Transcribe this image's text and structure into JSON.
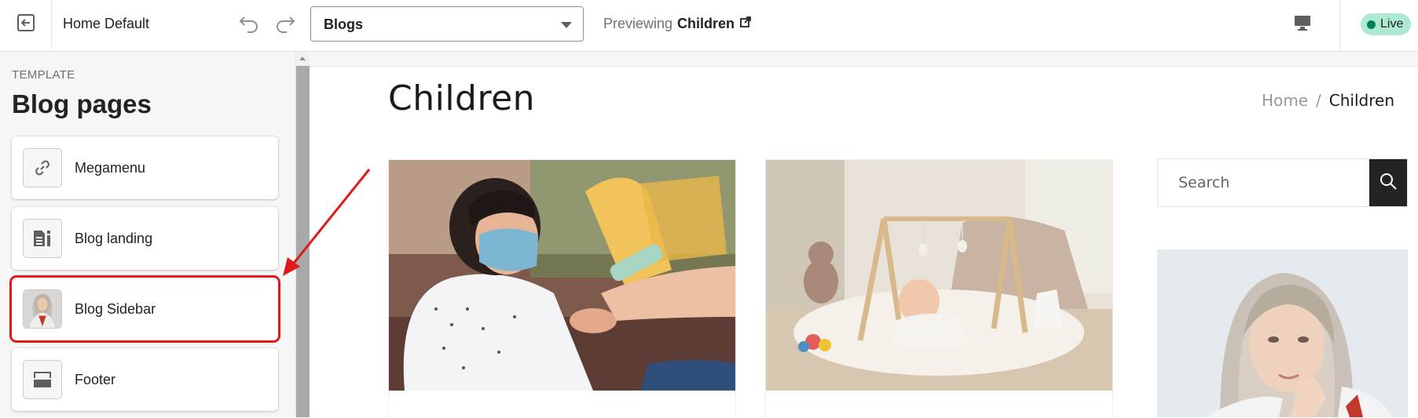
{
  "topbar": {
    "theme_name": "Home Default",
    "template_select_value": "Blogs",
    "previewing_label": "Previewing",
    "previewing_page": "Children",
    "status_badge": "Live"
  },
  "sidebar": {
    "section_label": "TEMPLATE",
    "title": "Blog pages",
    "items": [
      {
        "label": "Megamenu",
        "icon": "link-icon"
      },
      {
        "label": "Blog landing",
        "icon": "blog-landing-icon"
      },
      {
        "label": "Blog Sidebar",
        "icon": "blog-sidebar-thumbnail",
        "highlighted": true
      },
      {
        "label": "Footer",
        "icon": "footer-layout-icon"
      }
    ]
  },
  "preview": {
    "page_title": "Children",
    "breadcrumb": {
      "home": "Home",
      "separator": "/",
      "current": "Children"
    },
    "search": {
      "placeholder": "Search"
    },
    "posts": [
      {
        "image": "child-hand-sanitizer-photo"
      },
      {
        "image": "baby-play-gym-photo"
      }
    ],
    "sidebar_image": "woman-portrait-photo"
  },
  "colors": {
    "annotation": "#e01a1a",
    "live_badge": "#aee9d1",
    "search_button": "#232323"
  }
}
